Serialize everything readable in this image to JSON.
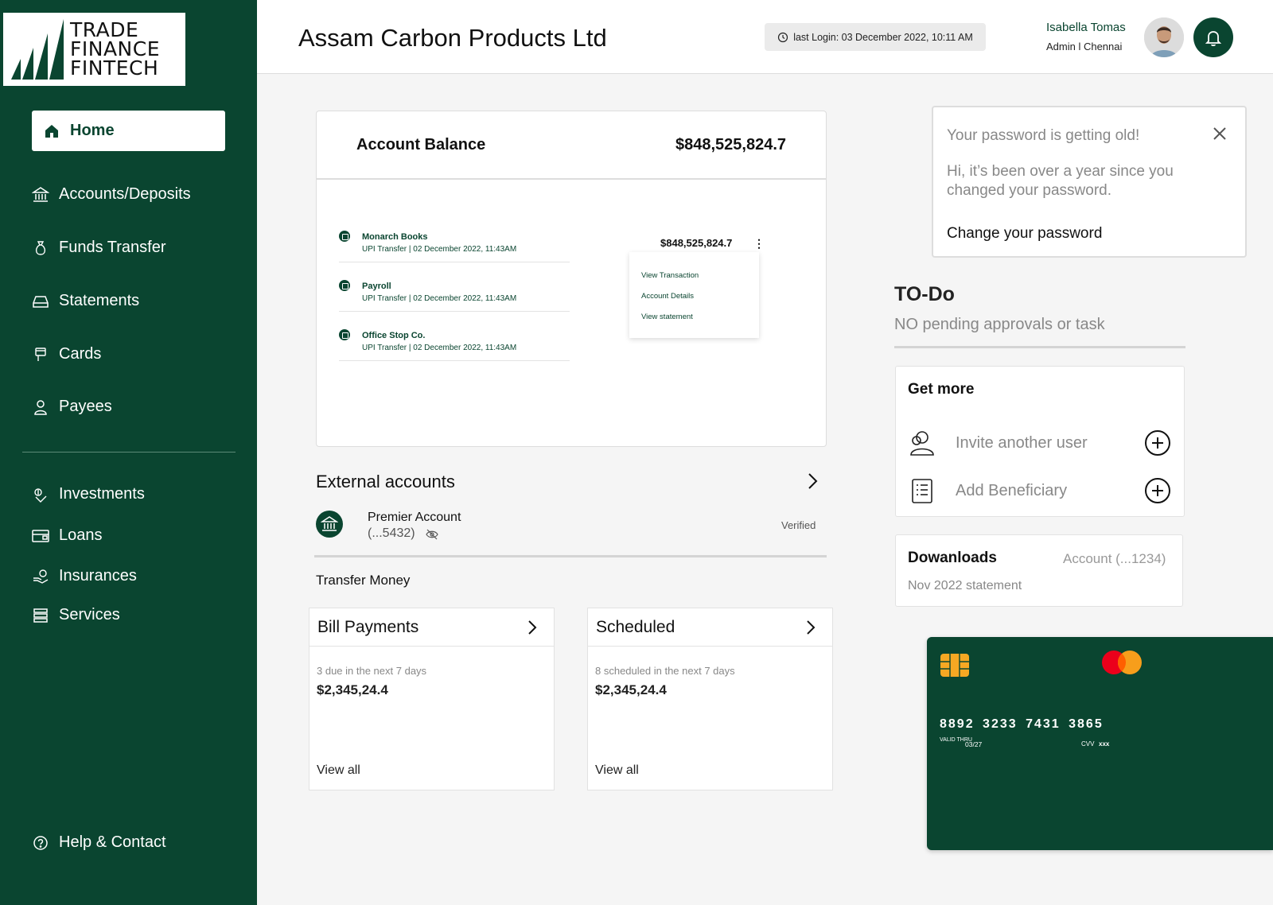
{
  "brand": {
    "logo_lines": [
      "TRADE",
      "FINANCE",
      "FINTECH"
    ],
    "primary_color": "#0a4530",
    "accent_color": "#f6a823"
  },
  "sidebar": {
    "items": [
      {
        "label": "Home",
        "icon": "home-icon"
      },
      {
        "label": "Accounts/Deposits",
        "icon": "bank-icon"
      },
      {
        "label": "Funds Transfer",
        "icon": "money-bag-icon"
      },
      {
        "label": "Statements",
        "icon": "inbox-icon"
      },
      {
        "label": "Cards",
        "icon": "card-icon"
      },
      {
        "label": "Payees",
        "icon": "user-icon"
      },
      {
        "label": "Investments",
        "icon": "investment-icon"
      },
      {
        "label": "Loans",
        "icon": "wallet-icon"
      },
      {
        "label": "Insurances",
        "icon": "insurance-icon"
      },
      {
        "label": "Services",
        "icon": "services-icon"
      },
      {
        "label": "Help & Contact",
        "icon": "help-icon"
      }
    ]
  },
  "header": {
    "company": "Assam Carbon Products Ltd",
    "last_login": "last Login: 03 December 2022, 10:11 AM",
    "user_name": "Isabella Tomas",
    "user_role": "Admin l Chennai"
  },
  "balance": {
    "label": "Account Balance",
    "amount": "$848,525,824.7",
    "transactions": [
      {
        "name": "Monarch Books",
        "detail": "UPI Transfer | 02 December 2022, 11:43AM"
      },
      {
        "name": "Payroll",
        "detail": "UPI Transfer | 02 December 2022, 11:43AM"
      },
      {
        "name": "Office Stop Co.",
        "detail": "UPI Transfer | 02 December 2022, 11:43AM"
      }
    ],
    "txn_amount": "$848,525,824.7",
    "menu": [
      "View Transaction",
      "Account Details",
      "View statement"
    ]
  },
  "external": {
    "title": "External accounts",
    "account_name": "Premier Account",
    "account_number": "(...5432)",
    "status": "Verified"
  },
  "transfer": {
    "title": "Transfer Money",
    "cards": [
      {
        "title": "Bill Payments",
        "sub": "3 due in the next 7 days",
        "amount": "$2,345,24.4",
        "link": "View all"
      },
      {
        "title": "Scheduled",
        "sub": "8 scheduled in the next 7 days",
        "amount": "$2,345,24.4",
        "link": "View all"
      }
    ]
  },
  "password_notice": {
    "title": "Your password is getting old!",
    "body": "Hi, it’s been over a year since you changed your password.",
    "link": "Change your password"
  },
  "todo": {
    "title": "TO-Do",
    "subtitle": "NO pending approvals or task"
  },
  "get_more": {
    "title": "Get more",
    "items": [
      {
        "label": "Invite another user",
        "icon": "invite-user-icon"
      },
      {
        "label": "Add Beneficiary",
        "icon": "beneficiary-list-icon"
      }
    ]
  },
  "downloads": {
    "title": "Dowanloads",
    "account": "Account (...1234)",
    "file": "Nov 2022 statement"
  },
  "card": {
    "number": "8892 3233 7431 3865",
    "valid_label": "VALID THRU",
    "valid": "03/27",
    "cvv_label": "CVV",
    "cvv": "xxx"
  }
}
